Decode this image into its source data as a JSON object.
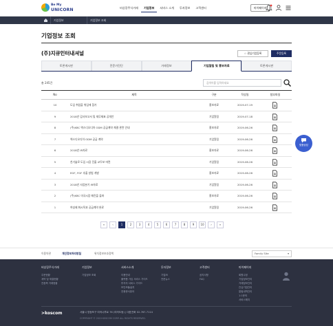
{
  "header": {
    "logo_line1": "Be My",
    "logo_line2": "UNICORN",
    "nav": [
      "비상장주식거래",
      "기업정보",
      "서비스 소개",
      "투자정보",
      "고객센터"
    ],
    "nav_active_index": 1,
    "mypage_label": "마이페이지"
  },
  "breadcrumb": {
    "items": [
      "기업정보",
      "기업정보 조회"
    ]
  },
  "page": {
    "title": "기업정보 조회",
    "company": "(주)지큐인터내셔널",
    "fav_button": "☆ 관심기업등록",
    "reg_button": "주문등록"
  },
  "tabs": [
    "토론게시판",
    "전문가진단",
    "거래정보",
    "기업알림 및 홍보자료",
    "토론게시판"
  ],
  "active_tab_index": 3,
  "list": {
    "count_label": "총 245건",
    "search_placeholder": "검색어를 입력하세요",
    "columns": [
      "No",
      "제목",
      "구분",
      "작성일",
      "첨부파일"
    ],
    "rows": [
      {
        "no": "10",
        "title": "도입 취업을 위임에 참가",
        "type": "홍보자료",
        "date": "2019-07-19"
      },
      {
        "no": "9",
        "title": "2018년 감사보고서 및 재무제표 공개안",
        "type": "기업알림",
        "date": "2019-07-18"
      },
      {
        "no": "8",
        "title": "(주)KBC 엑스디오디아 ODM 공급계약 체결 관련 안내",
        "type": "홍보자료",
        "date": "2019-06-26"
      },
      {
        "no": "7",
        "title": "엑스디오디아 ODM 공급 계약",
        "type": "기업알림",
        "date": "2019-06-26"
      },
      {
        "no": "6",
        "title": "2018년 IR자료",
        "type": "홍보자료",
        "date": "2019-06-26"
      },
      {
        "no": "5",
        "title": "친기술로 도입 시장 진출 교두보 마련",
        "type": "기업알림",
        "date": "2019-06-26"
      },
      {
        "no": "4",
        "title": "EGF, FGF 추출 방법 개발",
        "type": "홍보자료",
        "date": "2019-06-26"
      },
      {
        "no": "3",
        "title": "2018년 사업분기 IR자료",
        "type": "기업알림",
        "date": "2019-06-26"
      },
      {
        "no": "2",
        "title": "(주)KBC 미국시장 매진을 돌파",
        "type": "홍보자료",
        "date": "2019-06-26"
      },
      {
        "no": "1",
        "title": "여성제 화시직과 공급계약 완료",
        "type": "기업알림",
        "date": "2019-06-26"
      }
    ]
  },
  "float_badge": "맞춤상담",
  "pagination": {
    "prev_group": "«",
    "prev": "‹",
    "pages": [
      "1",
      "2",
      "3",
      "4",
      "5",
      "6",
      "7",
      "8",
      "9",
      "10"
    ],
    "active_page": "1",
    "next": "›",
    "next_group": "»"
  },
  "footer_links": {
    "items": [
      "이용약관",
      "개인정보처리방침",
      "위치정보보호정책"
    ],
    "strong_index": 1,
    "family_site": "Family Site"
  },
  "footer": {
    "columns": [
      {
        "heading": "비상장주식거래",
        "items": [
          "주문현황",
          "계약 및 체결현황",
          "전종목 거래현황"
        ]
      },
      {
        "heading": "기업정보",
        "items": [
          "기업정보 조회"
        ]
      },
      {
        "heading": "서비스소개",
        "items": [
          "이용안내",
          "플랫폼 가입 서비스 가이드",
          "투자자 서비스 가이드",
          "보안모듈설치",
          "전용문서뷰어"
        ]
      },
      {
        "heading": "투자정보",
        "items": [
          "기업IR",
          "전문뉴스"
        ]
      },
      {
        "heading": "고객센터",
        "items": [
          "공지사항",
          "FAQ"
        ]
      },
      {
        "heading": "마이페이지",
        "items": [
          "회원수정",
          "기업정보관리",
          "거래정보관리",
          "관심기업관리",
          "알림내역관리",
          "1:1문의",
          "서비스해지"
        ]
      }
    ],
    "brand": ">koscom",
    "address": "서울시 영등포구 여의나루로 76 (여의도동)  |  대표전화 02-767-7114",
    "copyright": "COPYRIGHT © 2019 KOSCOM CORP. ALL RIGHTS RESERVED."
  }
}
